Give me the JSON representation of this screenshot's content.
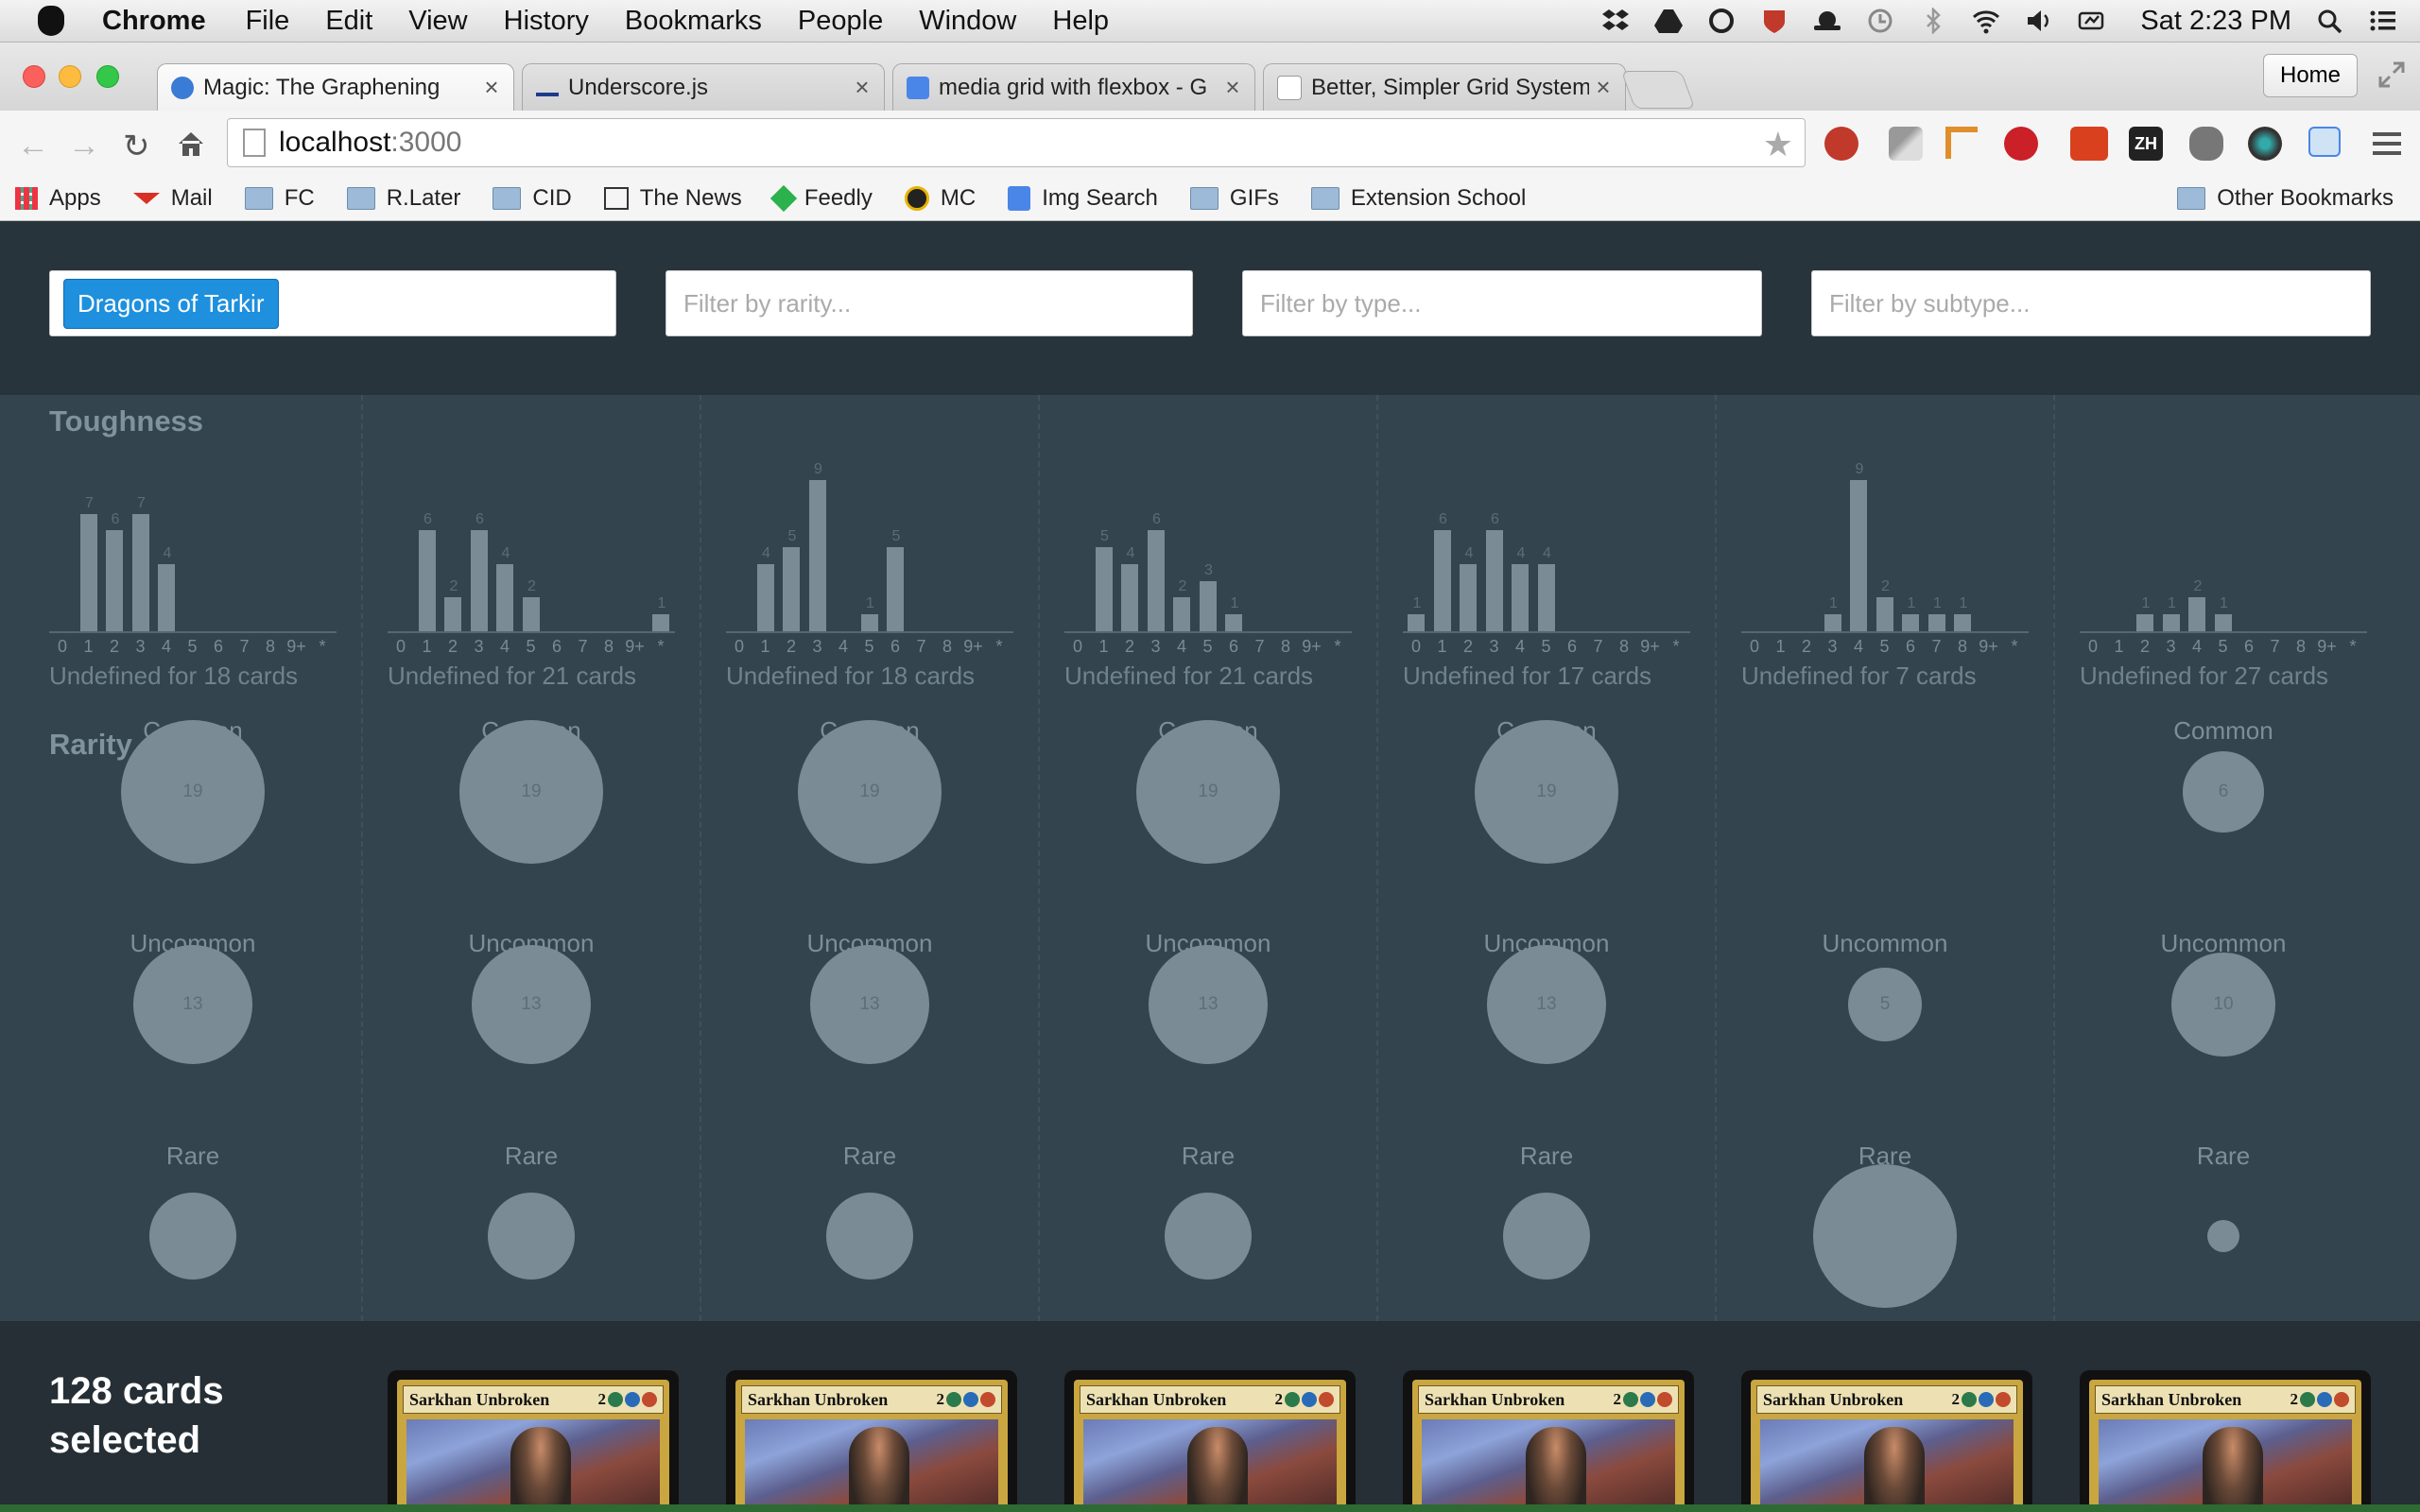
{
  "menubar": {
    "app_name": "Chrome",
    "items": [
      "File",
      "Edit",
      "View",
      "History",
      "Bookmarks",
      "People",
      "Window",
      "Help"
    ],
    "clock": "Sat 2:23 PM"
  },
  "tabs": [
    {
      "title": "Magic: The Graphening",
      "favicon_color": "#3a7bd5"
    },
    {
      "title": "Underscore.js",
      "favicon_color": "#1d3b8c"
    },
    {
      "title": "media grid with flexbox - G",
      "favicon_color": "#4a86e8"
    },
    {
      "title": "Better, Simpler Grid System",
      "favicon_color": "#dddddd"
    }
  ],
  "home_label": "Home",
  "omnibox": {
    "host": "localhost",
    "port": ":3000"
  },
  "bookmarks": {
    "items": [
      {
        "label": "Apps",
        "icon": "apps-grid-icon"
      },
      {
        "label": "Mail",
        "icon": "gmail-icon"
      },
      {
        "label": "FC",
        "icon": "folder-icon"
      },
      {
        "label": "R.Later",
        "icon": "folder-icon"
      },
      {
        "label": "CID",
        "icon": "folder-icon"
      },
      {
        "label": "The News",
        "icon": "news-icon"
      },
      {
        "label": "Feedly",
        "icon": "feedly-icon"
      },
      {
        "label": "MC",
        "icon": "mc-icon"
      },
      {
        "label": "Img Search",
        "icon": "google-icon"
      },
      {
        "label": "GIFs",
        "icon": "folder-icon"
      },
      {
        "label": "Extension School",
        "icon": "folder-icon"
      }
    ],
    "other": "Other Bookmarks"
  },
  "filters": {
    "set_tag": "Dragons of Tarkir",
    "rarity_placeholder": "Filter by rarity...",
    "type_placeholder": "Filter by type...",
    "subtype_placeholder": "Filter by subtype..."
  },
  "sections": {
    "toughness": "Toughness",
    "rarity": "Rarity"
  },
  "tick_labels": [
    "0",
    "1",
    "2",
    "3",
    "4",
    "5",
    "6",
    "7",
    "8",
    "9+",
    "*"
  ],
  "columns": [
    {
      "toughness": [
        0,
        7,
        6,
        7,
        4,
        0,
        0,
        0,
        0,
        0,
        0
      ],
      "undefined_text": "Undefined for 18 cards",
      "rarity": [
        {
          "label": "Common",
          "count": 19
        },
        {
          "label": "Uncommon",
          "count": 13
        },
        {
          "label": "Rare",
          "count": 7
        }
      ]
    },
    {
      "toughness": [
        0,
        6,
        2,
        6,
        4,
        2,
        0,
        0,
        0,
        0,
        1
      ],
      "undefined_text": "Undefined for 21 cards",
      "rarity": [
        {
          "label": "Common",
          "count": 19
        },
        {
          "label": "Uncommon",
          "count": 13
        },
        {
          "label": "Rare",
          "count": 7
        }
      ]
    },
    {
      "toughness": [
        0,
        4,
        5,
        9,
        0,
        1,
        5,
        0,
        0,
        0,
        0
      ],
      "undefined_text": "Undefined for 18 cards",
      "rarity": [
        {
          "label": "Common",
          "count": 19
        },
        {
          "label": "Uncommon",
          "count": 13
        },
        {
          "label": "Rare",
          "count": 7
        }
      ]
    },
    {
      "toughness": [
        0,
        5,
        4,
        6,
        2,
        3,
        1,
        0,
        0,
        0,
        0
      ],
      "undefined_text": "Undefined for 21 cards",
      "rarity": [
        {
          "label": "Common",
          "count": 19
        },
        {
          "label": "Uncommon",
          "count": 13
        },
        {
          "label": "Rare",
          "count": 7
        }
      ]
    },
    {
      "toughness": [
        1,
        6,
        4,
        6,
        4,
        4,
        0,
        0,
        0,
        0,
        0
      ],
      "undefined_text": "Undefined for 17 cards",
      "rarity": [
        {
          "label": "Common",
          "count": 19
        },
        {
          "label": "Uncommon",
          "count": 13
        },
        {
          "label": "Rare",
          "count": 7
        }
      ]
    },
    {
      "toughness": [
        0,
        0,
        0,
        1,
        9,
        2,
        1,
        1,
        1,
        0,
        0
      ],
      "undefined_text": "Undefined for 7 cards",
      "rarity": [
        {
          "label": "Uncommon",
          "count": 5
        },
        {
          "label": "Rare",
          "count": 19
        }
      ]
    },
    {
      "toughness": [
        0,
        0,
        1,
        1,
        2,
        1,
        0,
        0,
        0,
        0,
        0
      ],
      "undefined_text": "Undefined for 27 cards",
      "rarity": [
        {
          "label": "Common",
          "count": 6
        },
        {
          "label": "Uncommon",
          "count": 10
        },
        {
          "label": "Rare",
          "count": 1
        }
      ]
    }
  ],
  "selection": {
    "count_text": "128 cards selected"
  },
  "cards": [
    {
      "name": "Sarkhan Unbroken",
      "cost": "2"
    },
    {
      "name": "Sarkhan Unbroken",
      "cost": "2"
    },
    {
      "name": "Sarkhan Unbroken",
      "cost": "2"
    },
    {
      "name": "Sarkhan Unbroken",
      "cost": "2"
    },
    {
      "name": "Sarkhan Unbroken",
      "cost": "2"
    },
    {
      "name": "Sarkhan Unbroken",
      "cost": "2"
    }
  ]
}
